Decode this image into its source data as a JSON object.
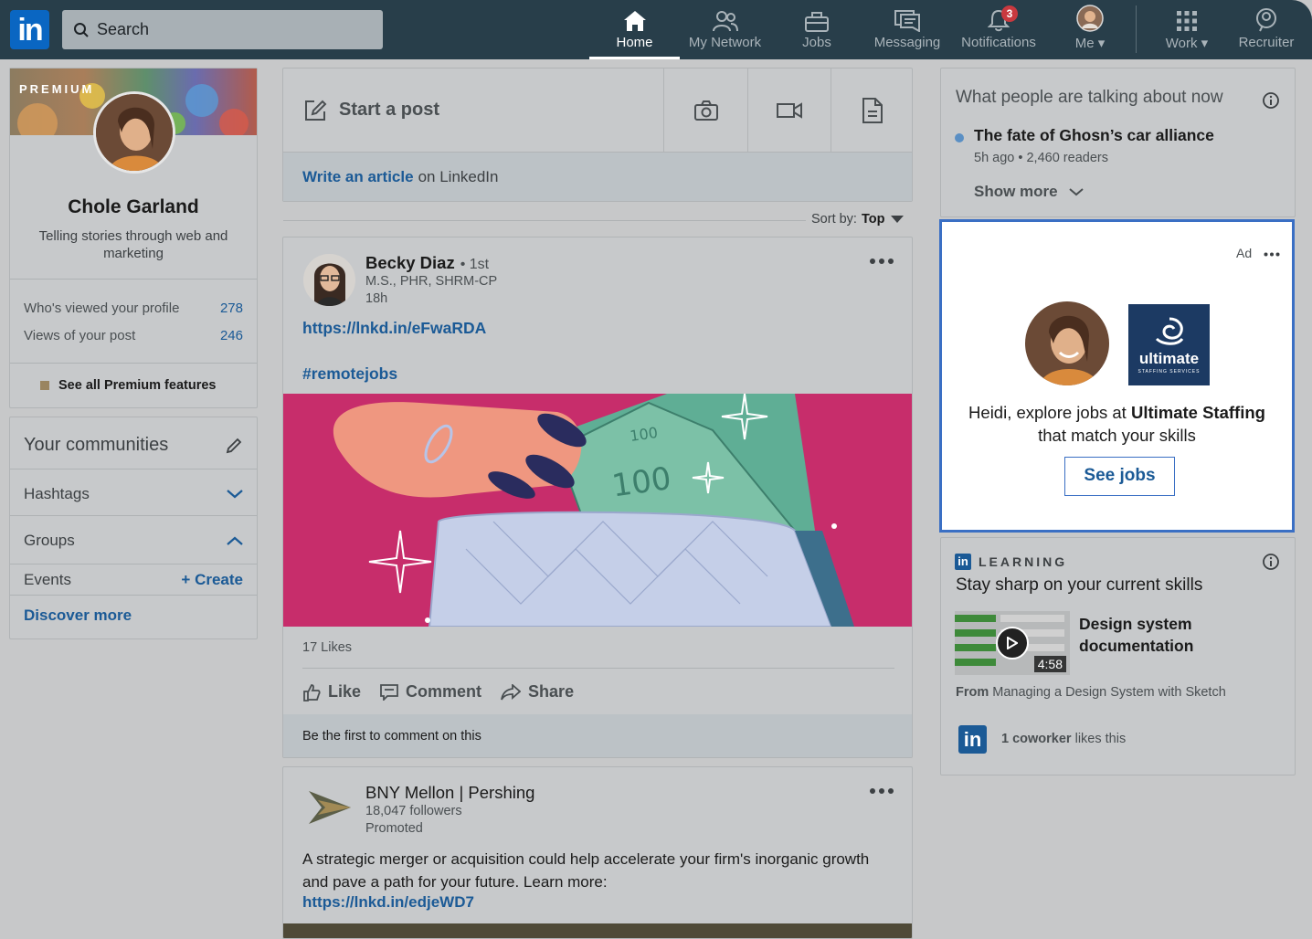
{
  "nav": {
    "logo_text": "in",
    "search_placeholder": "Search",
    "items": [
      {
        "label": "Home",
        "icon": "home-icon"
      },
      {
        "label": "My Network",
        "icon": "network-icon"
      },
      {
        "label": "Jobs",
        "icon": "briefcase-icon"
      },
      {
        "label": "Messaging",
        "icon": "messaging-icon"
      },
      {
        "label": "Notifications",
        "icon": "bell-icon",
        "badge": "3"
      },
      {
        "label": "Me",
        "icon": "avatar"
      },
      {
        "label": "Work",
        "icon": "grid-icon"
      },
      {
        "label": "Recruiter",
        "icon": "recruiter-icon"
      }
    ]
  },
  "profile": {
    "premium_label": "PREMIUM",
    "name": "Chole Garland",
    "headline": "Telling stories through web and marketing",
    "stats": [
      {
        "label": "Who's viewed your profile",
        "value": "278"
      },
      {
        "label": "Views of your post",
        "value": "246"
      }
    ],
    "premium_link": "See all Premium features"
  },
  "communities": {
    "title": "Your communities",
    "hashtags": "Hashtags",
    "groups": "Groups",
    "events": "Events",
    "create": "Create",
    "discover": "Discover more"
  },
  "composer": {
    "start_post": "Start a post",
    "write_article": "Write an article",
    "on_linkedin": "on LinkedIn"
  },
  "sort": {
    "label": "Sort by:",
    "value": "Top"
  },
  "post1": {
    "author": "Becky Diaz",
    "degree": "• 1st",
    "subtitle": "M.S., PHR, SHRM-CP",
    "time": "18h",
    "link": "https://lnkd.in/eFwaRDA",
    "hashtag": "#remotejobs",
    "likes": "17 Likes",
    "actions": [
      "Like",
      "Comment",
      "Share"
    ],
    "comment_prompt": "Be the first to comment on this",
    "image_banknote": "100",
    "image_banknote_small": "100"
  },
  "post2": {
    "author": "BNY Mellon | Pershing",
    "followers": "18,047 followers",
    "promoted": "Promoted",
    "text": "A strategic merger or acquisition could help accelerate your firm's inorganic growth and pave a path for your future. Learn more:",
    "link": "https://lnkd.in/edjeWD7"
  },
  "news": {
    "title": "What people are talking about now",
    "item_title": "The fate of Ghosn’s car alliance",
    "item_meta": "5h ago • 2,460 readers",
    "show_more": "Show more"
  },
  "ad": {
    "label": "Ad",
    "text_pre": "Heidi, explore jobs at ",
    "company": "Ultimate Staffing",
    "text_post": "that match your skills",
    "cta": "See jobs",
    "logo_text": "ultimate",
    "logo_sub": "STAFFING SERVICES"
  },
  "learning": {
    "label": "LEARNING",
    "title": "Stay sharp on your current skills",
    "course": "Design system documentation",
    "duration": "4:58",
    "from_label": "From",
    "from_course": "Managing a Design System with Sketch",
    "coworker_count": "1 coworker",
    "coworker_text": "likes this"
  },
  "colors": {
    "topbar": "#283e4a",
    "link": "#1b5a96",
    "ad_border": "#3a6fc4",
    "post_image_bg": "#c9246a"
  }
}
